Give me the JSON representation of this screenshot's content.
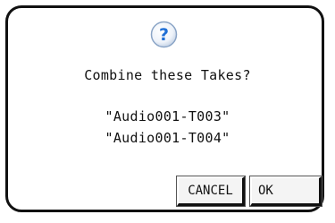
{
  "dialog": {
    "icon": "question-icon",
    "icon_glyph": "?",
    "question": "Combine these Takes?",
    "files": [
      "\"Audio001-T003\"",
      "\"Audio001-T004\""
    ],
    "buttons": {
      "cancel_label": "CANCEL",
      "ok_label": "OK"
    },
    "colors": {
      "icon_blue": "#1f6fd6",
      "border": "#111111",
      "background": "#ffffff"
    }
  }
}
